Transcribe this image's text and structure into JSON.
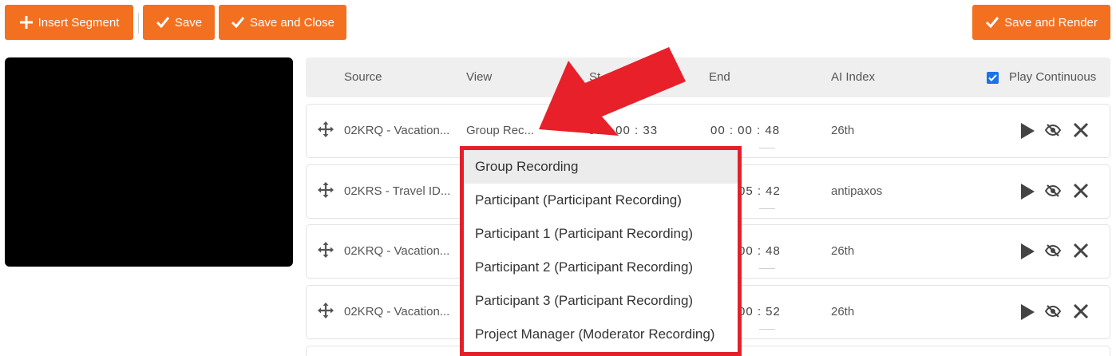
{
  "toolbar": {
    "insert_label": "Insert Segment",
    "save_label": "Save",
    "save_close_label": "Save and Close",
    "save_render_label": "Save and Render"
  },
  "table": {
    "headers": [
      "Source",
      "View",
      "St",
      "End",
      "AI Index"
    ],
    "play_continuous_label": "Play Continuous",
    "play_continuous_checked": true
  },
  "rows": [
    {
      "source": "02KRQ - Vacation...",
      "view": "Group Rec...",
      "start": "00 : 00 : 33",
      "end": "00 : 00 : 48",
      "ai_index": "26th"
    },
    {
      "source": "02KRS - Travel ID...",
      "view": "",
      "start": "",
      "end": "05 : 42",
      "ai_index": "antipaxos"
    },
    {
      "source": "02KRQ - Vacation...",
      "view": "",
      "start": "",
      "end": "00 : 48",
      "ai_index": "26th"
    },
    {
      "source": "02KRQ - Vacation...",
      "view": "",
      "start": "",
      "end": "00 : 52",
      "ai_index": "26th"
    }
  ],
  "dropdown": {
    "options": [
      "Group Recording",
      "Participant (Participant Recording)",
      "Participant 1 (Participant Recording)",
      "Participant 2 (Participant Recording)",
      "Participant 3 (Participant Recording)",
      "Project Manager (Moderator Recording)"
    ],
    "selected": "Group Recording"
  },
  "colors": {
    "accent": "#f37021",
    "highlight": "#e3202a",
    "checkbox": "#1a73e8"
  },
  "icons": [
    "plus-icon",
    "check-icon",
    "move-icon",
    "play-icon",
    "eye-off-icon",
    "close-icon",
    "red-arrow"
  ]
}
